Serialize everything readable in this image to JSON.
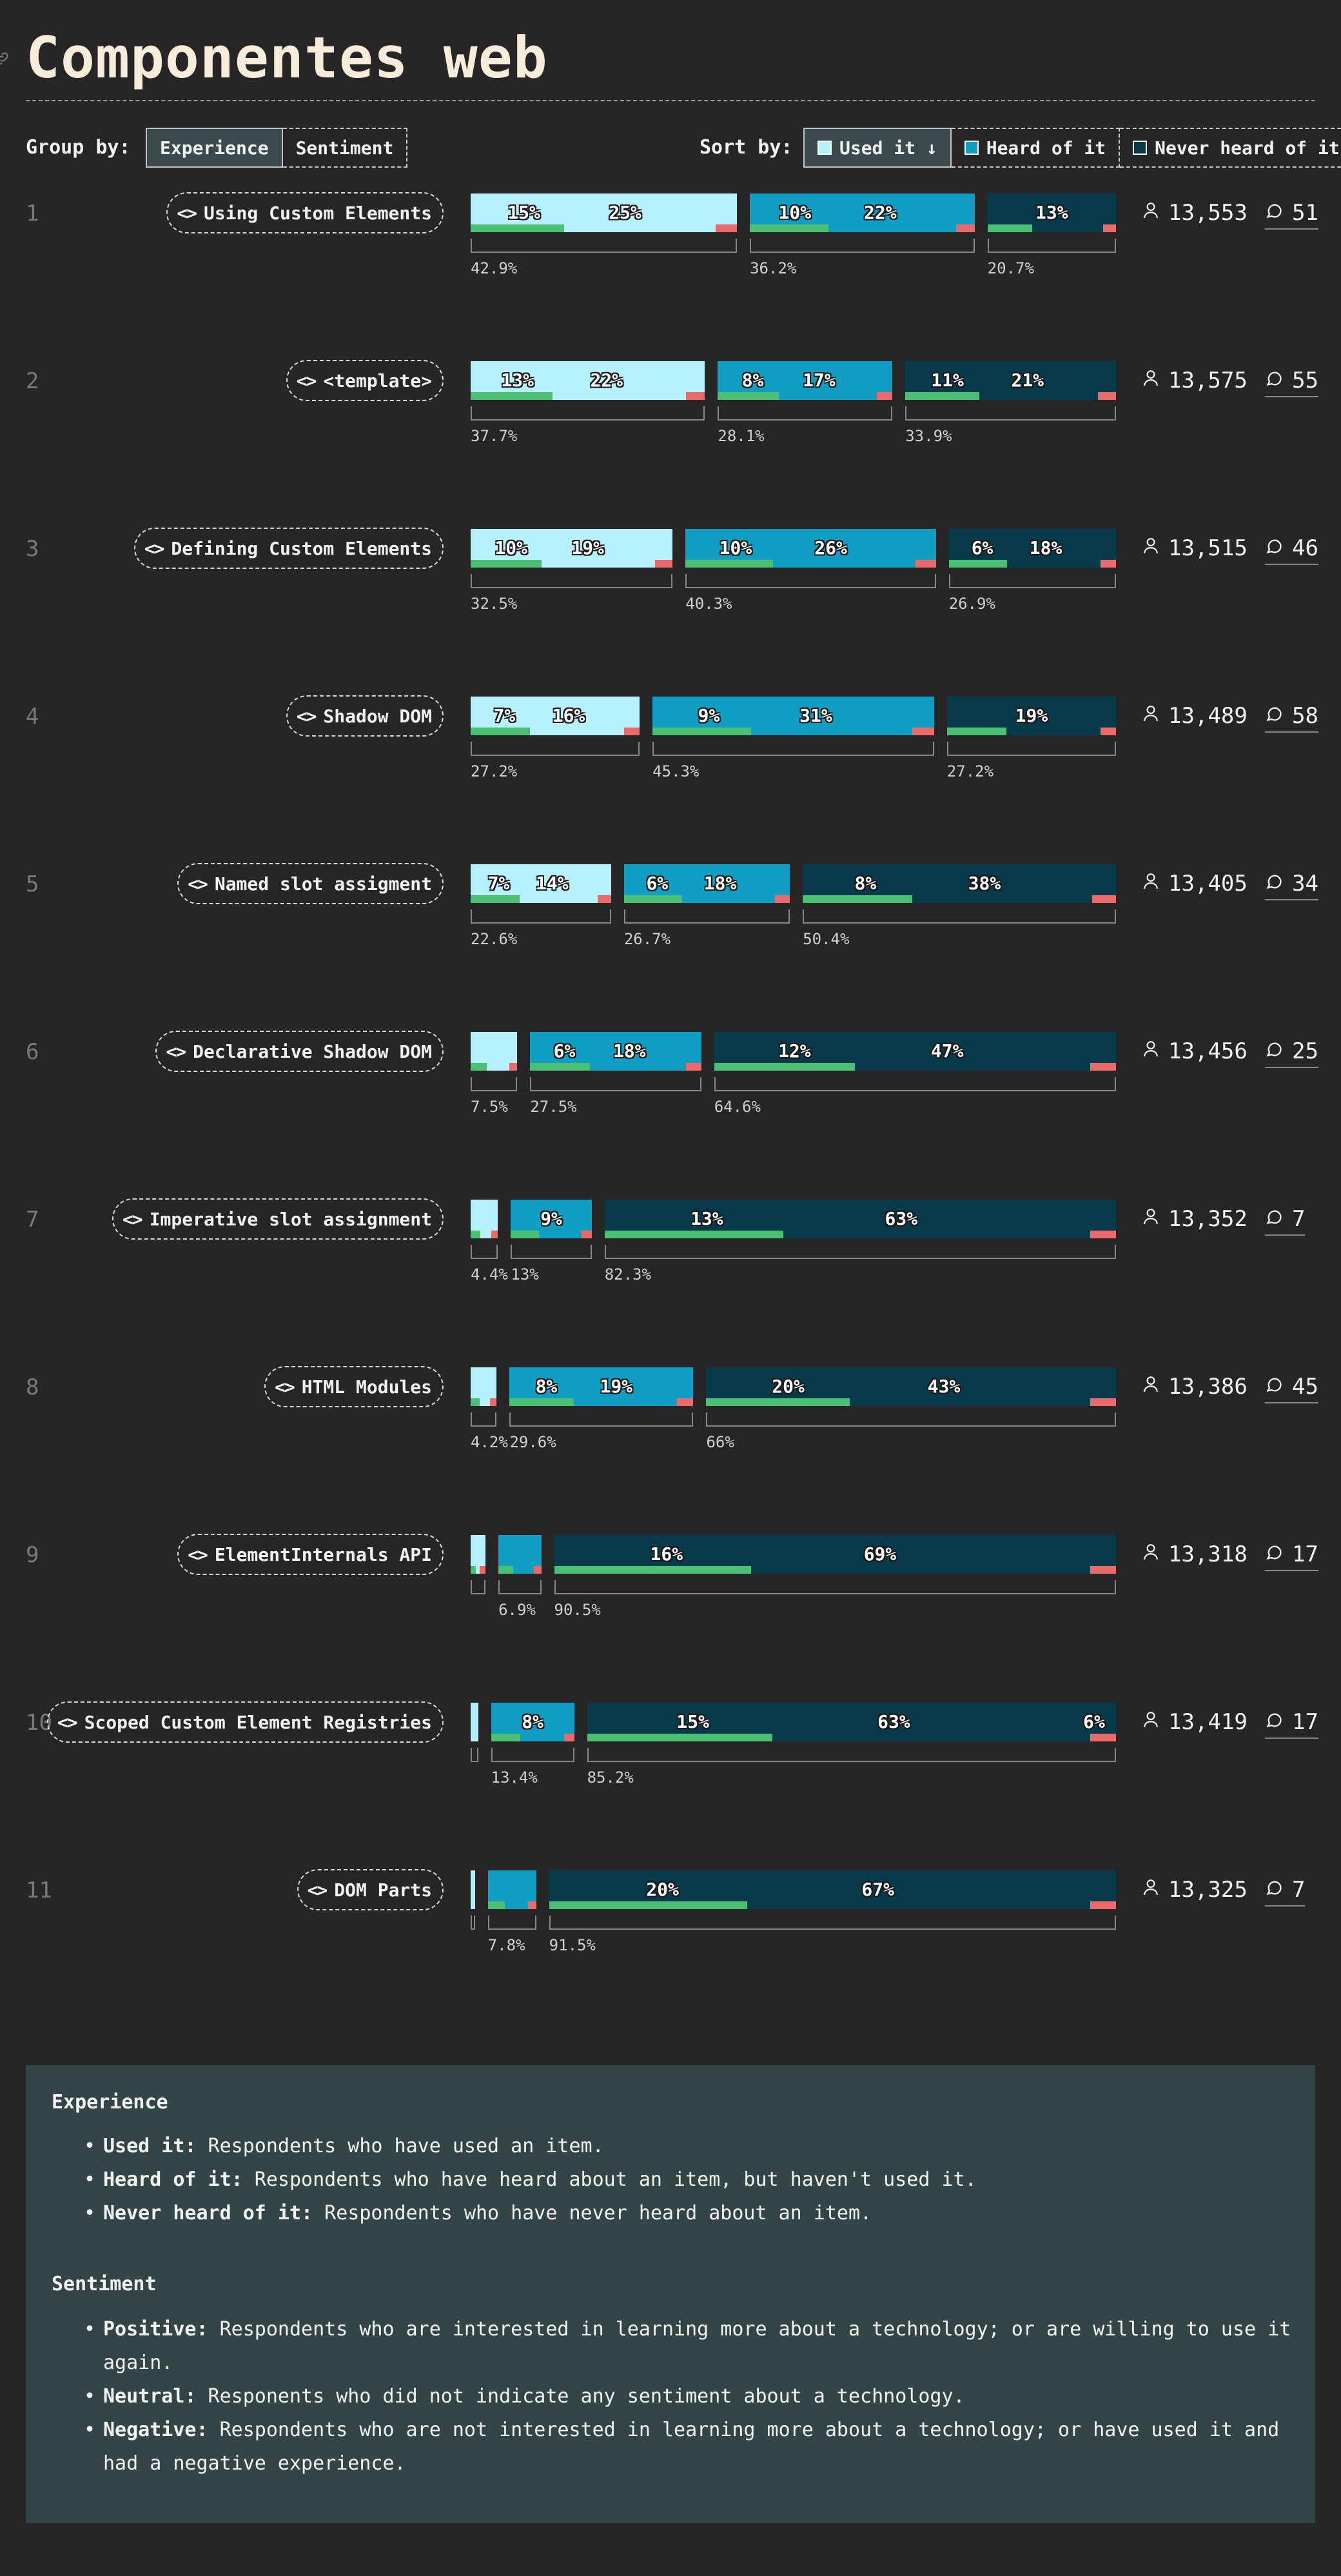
{
  "page": {
    "title": "Componentes web"
  },
  "controls": {
    "group_by_label": "Group by:",
    "group_options": [
      "Experience",
      "Sentiment"
    ],
    "group_active": "Experience",
    "sort_by_label": "Sort by:",
    "sort_options": [
      "Used it ↓",
      "Heard of it",
      "Never heard of it"
    ],
    "sort_active": "Used it ↓"
  },
  "colors": {
    "used": "#b6f1fd",
    "heard": "#129ec2",
    "never": "#073a4a",
    "positive": "#4bbf73",
    "negative": "#e86a6a"
  },
  "chart_data": {
    "type": "bar",
    "orientation": "horizontal",
    "layout": "grouped-segments",
    "categories": [
      "Used it",
      "Heard of it",
      "Never heard of it"
    ],
    "rows": [
      {
        "rank": "1",
        "name": "Using Custom Elements",
        "respondents": "13,553",
        "comments": "51",
        "used": 42.9,
        "heard": 36.2,
        "never": 20.7,
        "used_labels": [
          "15%",
          "25%"
        ],
        "heard_labels": [
          "10%",
          "22%"
        ],
        "never_labels": [
          "",
          "13%"
        ],
        "used_pct_label": "42.9%",
        "heard_pct_label": "36.2%",
        "never_pct_label": "20.7%"
      },
      {
        "rank": "2",
        "name": "<template>",
        "respondents": "13,575",
        "comments": "55",
        "used": 37.7,
        "heard": 28.1,
        "never": 33.9,
        "used_labels": [
          "13%",
          "22%"
        ],
        "heard_labels": [
          "8%",
          "17%"
        ],
        "never_labels": [
          "11%",
          "21%"
        ],
        "used_pct_label": "37.7%",
        "heard_pct_label": "28.1%",
        "never_pct_label": "33.9%"
      },
      {
        "rank": "3",
        "name": "Defining Custom Elements",
        "respondents": "13,515",
        "comments": "46",
        "used": 32.5,
        "heard": 40.3,
        "never": 26.9,
        "used_labels": [
          "10%",
          "19%"
        ],
        "heard_labels": [
          "10%",
          "26%"
        ],
        "never_labels": [
          "6%",
          "18%"
        ],
        "used_pct_label": "32.5%",
        "heard_pct_label": "40.3%",
        "never_pct_label": "26.9%"
      },
      {
        "rank": "4",
        "name": "Shadow DOM",
        "respondents": "13,489",
        "comments": "58",
        "used": 27.2,
        "heard": 45.3,
        "never": 27.2,
        "used_labels": [
          "7%",
          "16%"
        ],
        "heard_labels": [
          "9%",
          "31%"
        ],
        "never_labels": [
          "",
          "19%"
        ],
        "used_pct_label": "27.2%",
        "heard_pct_label": "45.3%",
        "never_pct_label": "27.2%"
      },
      {
        "rank": "5",
        "name": "Named slot assigment",
        "respondents": "13,405",
        "comments": "34",
        "used": 22.6,
        "heard": 26.7,
        "never": 50.4,
        "used_labels": [
          "7%",
          "14%"
        ],
        "heard_labels": [
          "6%",
          "18%"
        ],
        "never_labels": [
          "8%",
          "38%"
        ],
        "used_pct_label": "22.6%",
        "heard_pct_label": "26.7%",
        "never_pct_label": "50.4%"
      },
      {
        "rank": "6",
        "name": "Declarative Shadow DOM",
        "respondents": "13,456",
        "comments": "25",
        "used": 7.5,
        "heard": 27.5,
        "never": 64.6,
        "used_labels": [
          "",
          ""
        ],
        "heard_labels": [
          "6%",
          "18%"
        ],
        "never_labels": [
          "12%",
          "47%"
        ],
        "used_pct_label": "7.5%",
        "heard_pct_label": "27.5%",
        "never_pct_label": "64.6%"
      },
      {
        "rank": "7",
        "name": "Imperative slot assignment",
        "respondents": "13,352",
        "comments": "7",
        "used": 4.4,
        "heard": 13,
        "never": 82.3,
        "used_labels": [
          "",
          ""
        ],
        "heard_labels": [
          "",
          "9%"
        ],
        "never_labels": [
          "13%",
          "63%"
        ],
        "used_pct_label": "4.4%",
        "heard_pct_label": "13%",
        "never_pct_label": "82.3%"
      },
      {
        "rank": "8",
        "name": "HTML Modules",
        "respondents": "13,386",
        "comments": "45",
        "used": 4.2,
        "heard": 29.6,
        "never": 66,
        "used_labels": [
          "",
          ""
        ],
        "heard_labels": [
          "8%",
          "19%"
        ],
        "never_labels": [
          "20%",
          "43%"
        ],
        "used_pct_label": "4.2%",
        "heard_pct_label": "29.6%",
        "never_pct_label": "66%"
      },
      {
        "rank": "9",
        "name": "ElementInternals API",
        "respondents": "13,318",
        "comments": "17",
        "used": 2.4,
        "heard": 6.9,
        "never": 90.5,
        "used_labels": [
          "",
          ""
        ],
        "heard_labels": [
          "",
          ""
        ],
        "never_labels": [
          "16%",
          "69%"
        ],
        "used_pct_label": "",
        "heard_pct_label": "6.9%",
        "never_pct_label": "90.5%"
      },
      {
        "rank": "10",
        "name": "Scoped Custom Element Registries",
        "respondents": "13,419",
        "comments": "17",
        "used": 1.2,
        "heard": 13.4,
        "never": 85.2,
        "used_labels": [
          "",
          ""
        ],
        "heard_labels": [
          "",
          "8%"
        ],
        "never_labels": [
          "15%",
          "63%"
        ],
        "never_neg_label": "6%",
        "used_pct_label": "",
        "heard_pct_label": "13.4%",
        "never_pct_label": "85.2%"
      },
      {
        "rank": "11",
        "name": "DOM Parts",
        "respondents": "13,325",
        "comments": "7",
        "used": 0.7,
        "heard": 7.8,
        "never": 91.5,
        "used_labels": [
          "",
          ""
        ],
        "heard_labels": [
          "",
          ""
        ],
        "never_labels": [
          "20%",
          "67%"
        ],
        "used_pct_label": "",
        "heard_pct_label": "7.8%",
        "never_pct_label": "91.5%"
      }
    ]
  },
  "legend": {
    "experience_title": "Experience",
    "experience_items": [
      {
        "term": "Used it:",
        "text": " Respondents who have used an item."
      },
      {
        "term": "Heard of it:",
        "text": " Respondents who have heard about an item, but haven't used it."
      },
      {
        "term": "Never heard of it:",
        "text": " Respondents who have never heard about an item."
      }
    ],
    "sentiment_title": "Sentiment",
    "sentiment_items": [
      {
        "term": "Positive:",
        "text": " Respondents who are interested in learning more about a technology; or are willing to use it again."
      },
      {
        "term": "Neutral:",
        "text": " Responents who did not indicate any sentiment about a technology."
      },
      {
        "term": "Negative:",
        "text": " Respondents who are not interested in learning more about a technology; or have used it and had a negative experience."
      }
    ]
  }
}
